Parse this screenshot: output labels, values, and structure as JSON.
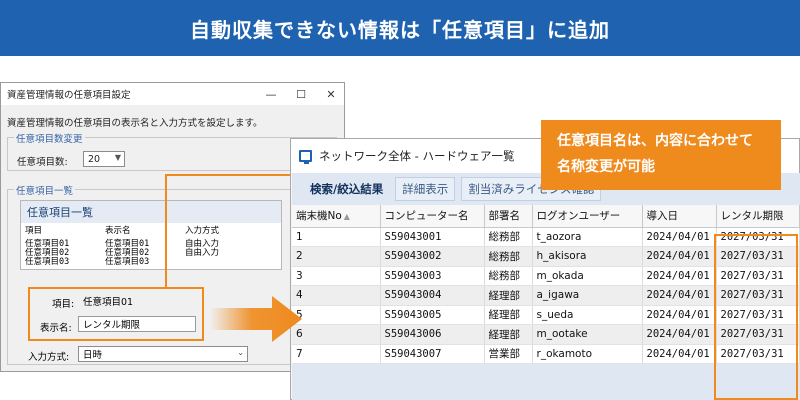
{
  "banner": {
    "title": "自動収集できない情報は「任意項目」に追加"
  },
  "dialog": {
    "title": "資産管理情報の任意項目設定",
    "minimize": "—",
    "maximize": "☐",
    "close": "✕",
    "description": "資産管理情報の任意項目の表示名と入力方式を設定します。",
    "count_group": "任意項目数変更",
    "count_label": "任意項目数:",
    "count_value": "20",
    "list_group": "任意項目一覧",
    "panel_title": "任意項目一覧",
    "table_headers": [
      "項目",
      "表示名",
      "入力方式"
    ],
    "table_rows": [
      [
        "任意項目01",
        "任意項目01",
        "自由入力"
      ],
      [
        "任意項目02",
        "任意項目02",
        "自由入力"
      ],
      [
        "任意項目03",
        "任意項目03",
        ""
      ]
    ],
    "item_label": "項目:",
    "item_value": "任意項目01",
    "display_label": "表示名:",
    "display_value": "レンタル期限",
    "input_label": "入力方式:",
    "input_value": "日時"
  },
  "callout": {
    "line1": "任意項目名は、内容に合わせて",
    "line2": "名称変更が可能"
  },
  "network": {
    "title": "ネットワーク全体 - ハードウェア一覧",
    "tabs": [
      "検索/絞込結果",
      "詳細表示",
      "割当済みライセンス確認"
    ],
    "columns": [
      "端末機No",
      "コンピューター名",
      "部署名",
      "ログオンユーザー",
      "導入日",
      "レンタル期限"
    ],
    "rows": [
      [
        "1",
        "S59043001",
        "総務部",
        "t_aozora",
        "2024/04/01",
        "2027/03/31"
      ],
      [
        "2",
        "S59043002",
        "総務部",
        "h_akisora",
        "2024/04/01",
        "2027/03/31"
      ],
      [
        "3",
        "S59043003",
        "総務部",
        "m_okada",
        "2024/04/01",
        "2027/03/31"
      ],
      [
        "4",
        "S59043004",
        "経理部",
        "a_igawa",
        "2024/04/01",
        "2027/03/31"
      ],
      [
        "5",
        "S59043005",
        "経理部",
        "s_ueda",
        "2024/04/01",
        "2027/03/31"
      ],
      [
        "6",
        "S59043006",
        "経理部",
        "m_ootake",
        "2024/04/01",
        "2027/03/31"
      ],
      [
        "7",
        "S59043007",
        "営業部",
        "r_okamoto",
        "2024/04/01",
        "2027/03/31"
      ]
    ]
  },
  "colors": {
    "banner": "#1f63b0",
    "accent": "#ef8a1d"
  }
}
